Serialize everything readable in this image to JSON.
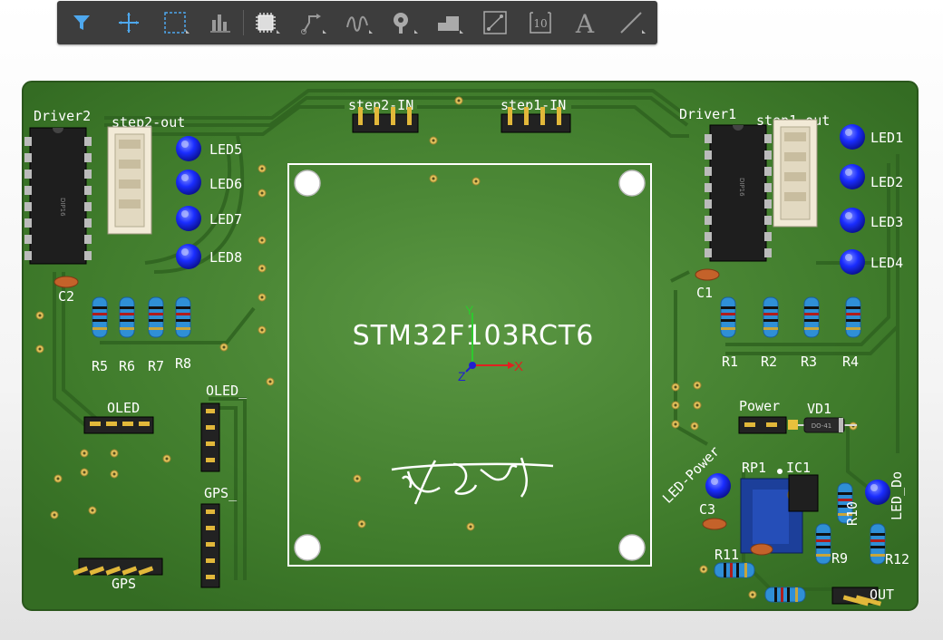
{
  "toolbar": {
    "tools": [
      {
        "icon": "filter-icon",
        "name": "filter"
      },
      {
        "icon": "crosshair-icon",
        "name": "move"
      },
      {
        "icon": "selection-rect-icon",
        "name": "select"
      },
      {
        "icon": "bar-chart-icon",
        "name": "align"
      },
      {
        "icon": "chip-icon",
        "name": "component"
      },
      {
        "icon": "route-icon",
        "name": "route"
      },
      {
        "icon": "differential-route-icon",
        "name": "diff-pair"
      },
      {
        "icon": "pad-icon",
        "name": "pad"
      },
      {
        "icon": "polygon-icon",
        "name": "polygon"
      },
      {
        "icon": "dimension-icon",
        "name": "dimension"
      },
      {
        "icon": "designator-icon",
        "name": "designator"
      },
      {
        "icon": "text-icon",
        "name": "text"
      },
      {
        "icon": "line-icon",
        "name": "line"
      }
    ],
    "designator_text": "10",
    "text_letter": "A"
  },
  "board": {
    "labels": {
      "driver2": "Driver2",
      "step2_out": "step2-out",
      "step2_in": "step2-IN",
      "step1_in": "step1-IN",
      "driver1": "Driver1",
      "step1_out": "step1-out",
      "led1": "LED1",
      "led2": "LED2",
      "led3": "LED3",
      "led4": "LED4",
      "led5": "LED5",
      "led6": "LED6",
      "led7": "LED7",
      "led8": "LED8",
      "c1": "C1",
      "c2": "C2",
      "c3": "C3",
      "r1": "R1",
      "r2": "R2",
      "r3": "R3",
      "r4": "R4",
      "r5": "R5",
      "r6": "R6",
      "r7": "R7",
      "r8": "R8",
      "r9": "R9",
      "r10": "R10",
      "r11": "R11",
      "r12": "R12",
      "oled": "OLED",
      "oled2": "OLED_",
      "gps": "GPS",
      "gps2": "GPS_",
      "power": "Power",
      "vd1": "VD1",
      "rp1": "RP1",
      "ic1": "IC1",
      "led_power": "LED-Power",
      "led_do": "LED_Do",
      "out": "OUT",
      "mcu": "STM32F103RCT6",
      "dip16": "DIP16",
      "diode": "DO-41"
    },
    "axes": {
      "x": "X",
      "y": "Y",
      "z": "Z"
    },
    "colors": {
      "board": "#3e7a2a",
      "silk": "#ffffff",
      "led": "#1a2dff",
      "resistor": "#2f8fd6",
      "header": "#222222",
      "accent": "#e8c13d"
    }
  }
}
